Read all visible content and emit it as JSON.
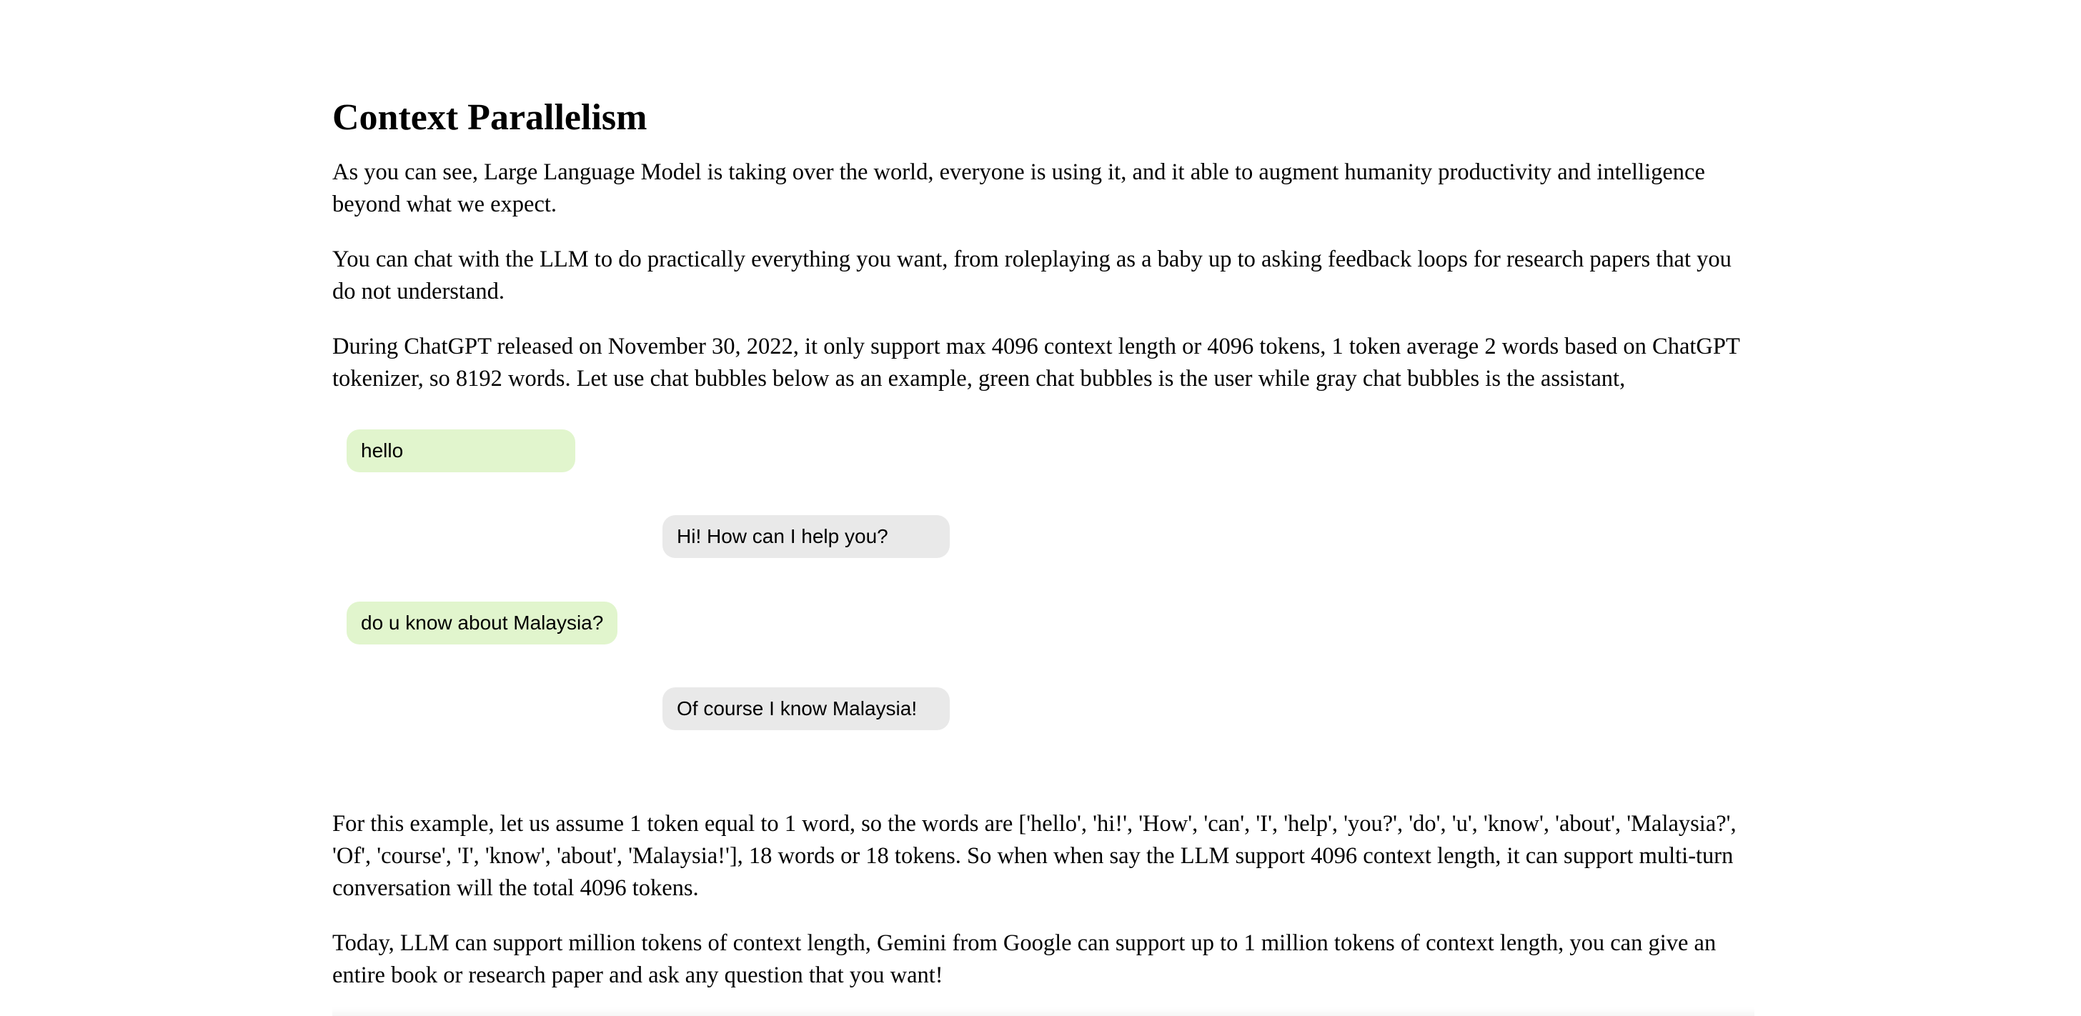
{
  "article": {
    "title": "Context Parallelism",
    "paragraphs_intro": [
      "As you can see, Large Language Model is taking over the world, everyone is using it, and it able to augment humanity productivity and intelligence beyond what we expect.",
      "You can chat with the LLM to do practically everything you want, from roleplaying as a baby up to asking feedback loops for research papers that you do not understand.",
      "During ChatGPT released on November 30, 2022, it only support max 4096 context length or 4096 tokens, 1 token average 2 words based on ChatGPT tokenizer, so 8192 words. Let use chat bubbles below as an example, green chat bubbles is the user while gray chat bubbles is the assistant,"
    ],
    "chat": [
      {
        "role": "user",
        "text": "hello"
      },
      {
        "role": "assistant",
        "text": "Hi! How can I help you?"
      },
      {
        "role": "user",
        "text": "do u know about Malaysia?"
      },
      {
        "role": "assistant",
        "text": "Of course I know Malaysia!"
      }
    ],
    "paragraphs_after": [
      "For this example, let us assume 1 token equal to 1 word, so the words are ['hello', 'hi!', 'How', 'can', 'I', 'help', 'you?', 'do', 'u', 'know', 'about', 'Malaysia?', 'Of', 'course', 'I', 'know', 'about', 'Malaysia!'], 18 words or 18 tokens. So when when say the LLM support 4096 context length, it can support multi-turn conversation will the total 4096 tokens.",
      "Today, LLM can support million tokens of context length, Gemini from Google can support up to 1 million tokens of context length, you can give an entire book or research paper and ask any question that you want!"
    ]
  },
  "colors": {
    "user_bubble": "#e1f5cd",
    "assistant_bubble": "#e9e9e9",
    "text": "#000000",
    "background": "#ffffff"
  }
}
